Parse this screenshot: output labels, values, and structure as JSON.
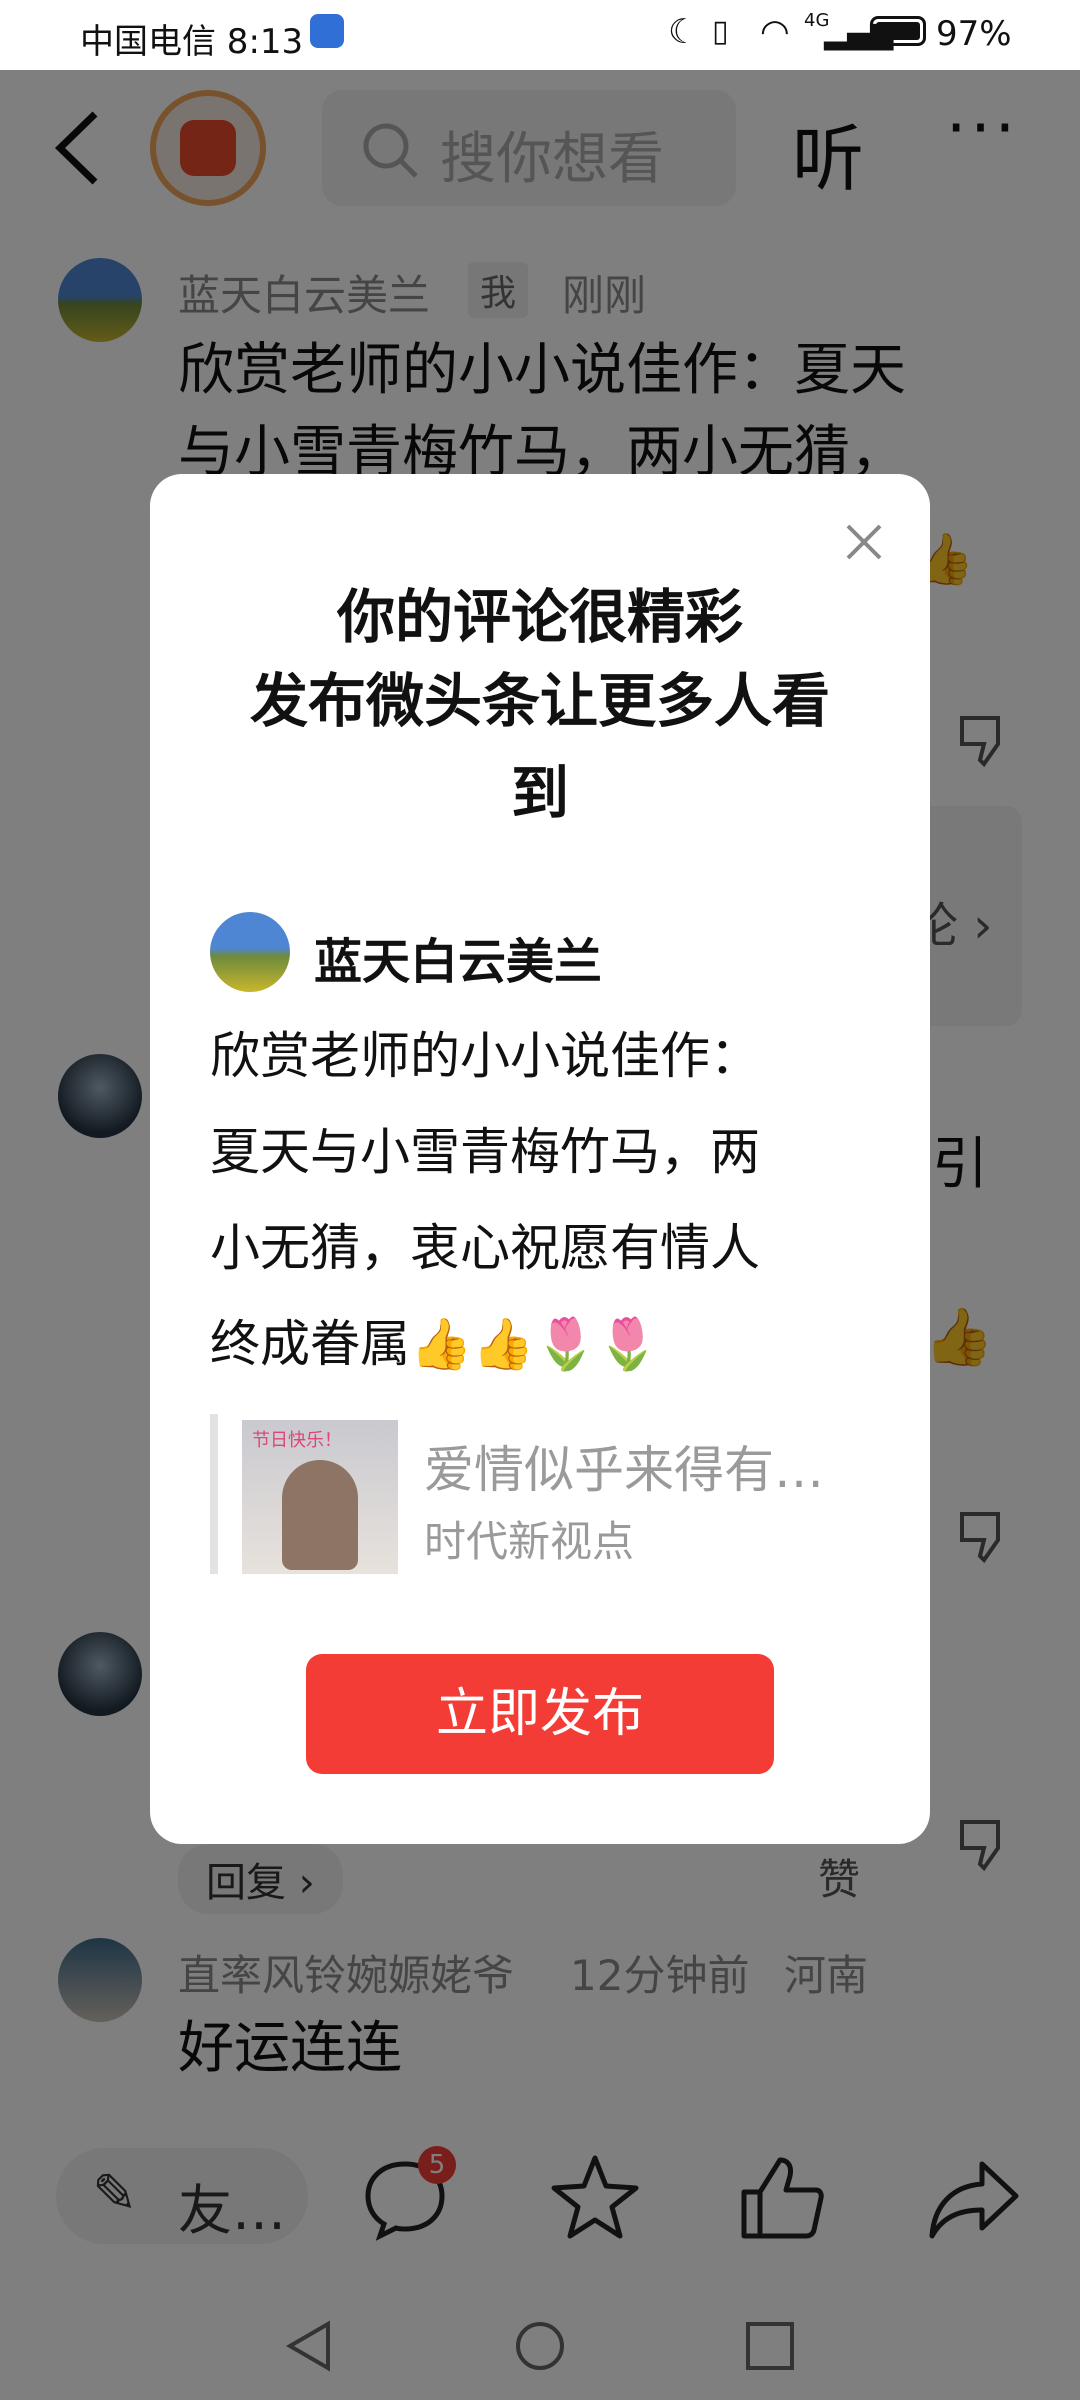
{
  "status_bar": {
    "carrier_time": "中国电信 8:13",
    "network": "4G",
    "battery": "97%"
  },
  "header": {
    "search_placeholder": "搜你想看",
    "listen_label": "听",
    "more_label": "···"
  },
  "comments": [
    {
      "name": "蓝天白云美兰",
      "tag": "我",
      "time": "刚刚",
      "lines": [
        "欣赏老师的小小说佳作：夏天",
        "与小雪青梅竹马，两小无猜，"
      ]
    },
    {
      "partial_text": "引"
    },
    {
      "reply_label": "回复 ›",
      "like_label": "赞"
    },
    {
      "name": "直率风铃婉嫄姥爷",
      "time": "12分钟前",
      "location": "河南",
      "text": "好运连连"
    }
  ],
  "side_fragment": "论 ›",
  "bottom_bar": {
    "input_label": "友…",
    "comment_badge": "5"
  },
  "modal": {
    "title_line1": "你的评论很精彩",
    "title_line2": "发布微头条让更多人看",
    "title_line3": "到",
    "author": "蓝天白云美兰",
    "body_lines": [
      "欣赏老师的小小说佳作：",
      "夏天与小雪青梅竹马，两",
      "小无猜，衷心祝愿有情人",
      "终成眷属👍👍🌷🌷"
    ],
    "quote_title": "爱情似乎来得有…",
    "quote_source": "时代新视点",
    "quote_thumb_text": "节日快乐！",
    "publish_label": "立即发布"
  },
  "colors": {
    "accent": "#f43c36",
    "overlay": "rgba(0,0,0,0.5)"
  }
}
